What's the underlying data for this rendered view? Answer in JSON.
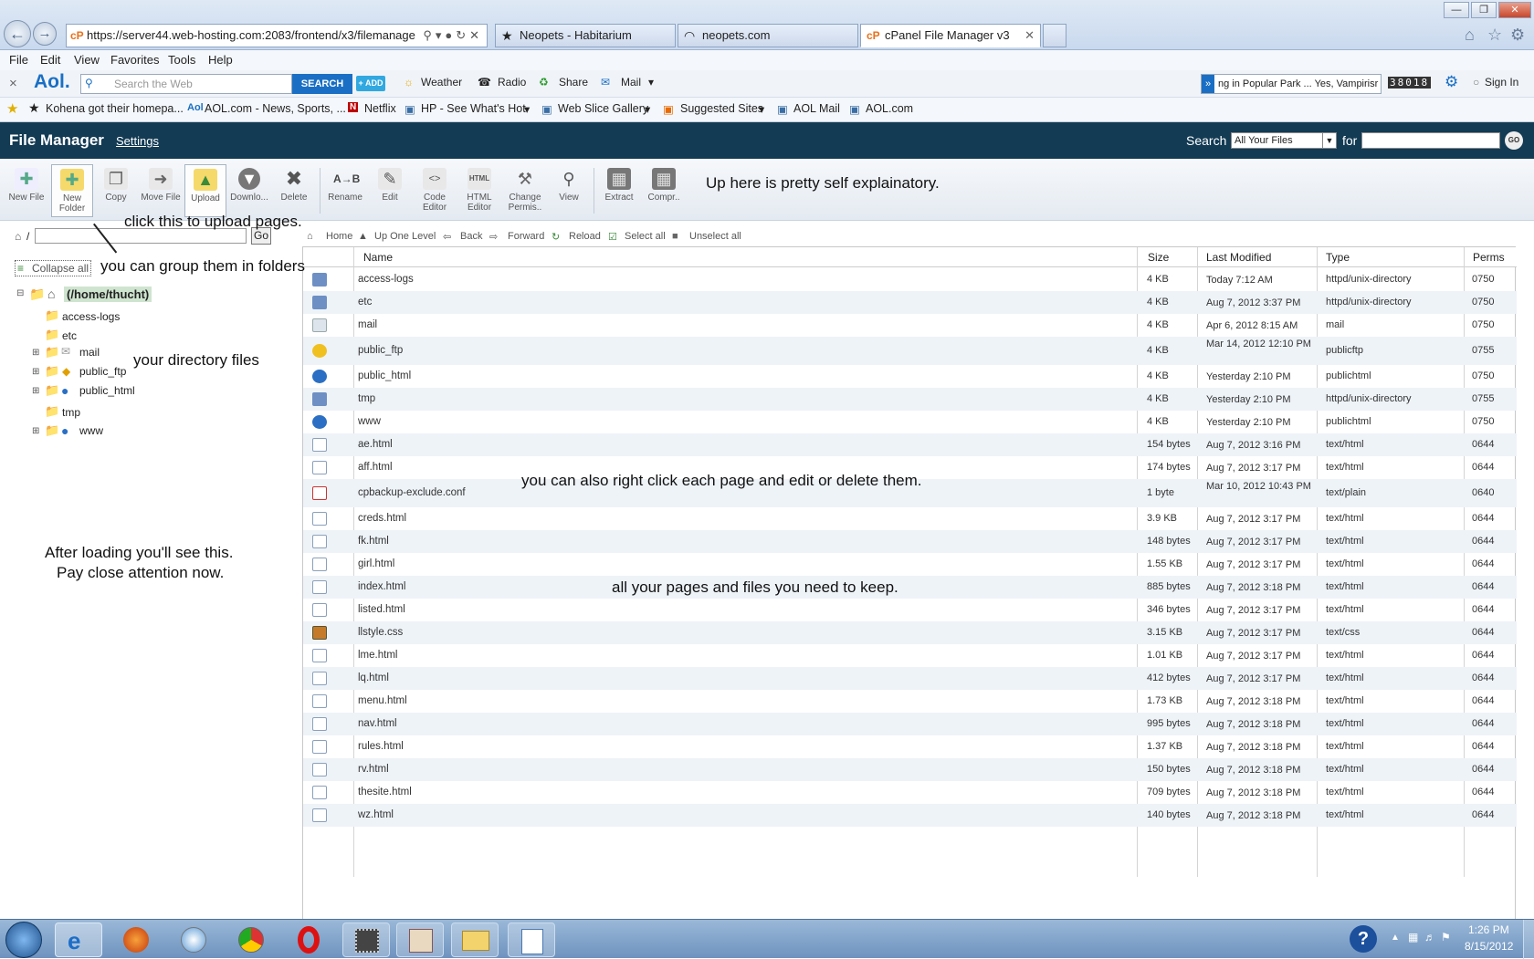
{
  "browser": {
    "address": "https://server44.web-hosting.com:2083/frontend/x3/filemanage",
    "tabs": [
      {
        "label": "Neopets - Habitarium",
        "icon": "star-icon"
      },
      {
        "label": "neopets.com",
        "icon": "loading-icon"
      },
      {
        "label": "cPanel File Manager v3",
        "icon": "cpanel-icon",
        "active": true
      }
    ],
    "menu": [
      "File",
      "Edit",
      "View",
      "Favorites",
      "Tools",
      "Help"
    ],
    "aol": {
      "logo": "Aol.",
      "search_placeholder": "Search the Web",
      "search_button": "SEARCH",
      "add_button": "+ ADD",
      "items": [
        "Weather",
        "Radio",
        "Share",
        "Mail"
      ],
      "ticker": "ng in Popular Park ...  Yes, Vampirisr",
      "counter": "38018",
      "sign_in": "Sign In"
    },
    "favorites": [
      "Kohena got their homepa...",
      "AOL.com - News, Sports, ...",
      "Netflix",
      "HP - See What's Hot",
      "Web Slice Gallery",
      "Suggested Sites",
      "AOL Mail",
      "AOL.com"
    ]
  },
  "cpanel": {
    "title": "File Manager",
    "settings": "Settings",
    "search_label": "Search",
    "search_scope": "All Your Files",
    "for_label": "for",
    "go": "GO",
    "toolbar": [
      {
        "label": "New File",
        "icon": "new-file-icon"
      },
      {
        "label": "New Folder",
        "icon": "new-folder-icon",
        "selected": true
      },
      {
        "label": "Copy",
        "icon": "copy-icon"
      },
      {
        "label": "Move File",
        "icon": "move-file-icon"
      },
      {
        "label": "Upload",
        "icon": "upload-icon",
        "selected": true
      },
      {
        "label": "Downlo...",
        "icon": "download-icon"
      },
      {
        "label": "Delete",
        "icon": "delete-icon"
      },
      {
        "label": "Rename",
        "icon": "rename-icon"
      },
      {
        "label": "Edit",
        "icon": "edit-icon"
      },
      {
        "label": "Code Editor",
        "icon": "code-editor-icon"
      },
      {
        "label": "HTML Editor",
        "icon": "html-editor-icon"
      },
      {
        "label": "Change Permis..",
        "icon": "permissions-icon"
      },
      {
        "label": "View",
        "icon": "view-icon"
      },
      {
        "label": "Extract",
        "icon": "extract-icon"
      },
      {
        "label": "Compr..",
        "icon": "compress-icon"
      }
    ],
    "path_prefix": "/",
    "path_go": "Go",
    "collapse_all": "Collapse all",
    "tree_root": "(/home/thucht)",
    "tree": [
      "access-logs",
      "etc",
      "mail",
      "public_ftp",
      "public_html",
      "tmp",
      "www"
    ],
    "nav": [
      "Home",
      "Up One Level",
      "Back",
      "Forward",
      "Reload",
      "Select all",
      "Unselect all"
    ],
    "columns": [
      "Name",
      "Size",
      "Last Modified",
      "Type",
      "Perms"
    ],
    "files": [
      {
        "name": "access-logs",
        "size": "4 KB",
        "modified": "Today 7:12 AM",
        "type": "httpd/unix-directory",
        "perms": "0750",
        "icon": "folder-icon"
      },
      {
        "name": "etc",
        "size": "4 KB",
        "modified": "Aug 7, 2012 3:37 PM",
        "type": "httpd/unix-directory",
        "perms": "0750",
        "icon": "folder-icon"
      },
      {
        "name": "mail",
        "size": "4 KB",
        "modified": "Apr 6, 2012 8:15 AM",
        "type": "mail",
        "perms": "0750",
        "icon": "mail-icon"
      },
      {
        "name": "public_ftp",
        "size": "4 KB",
        "modified": "Mar 14, 2012 12:10 PM",
        "type": "publicftp",
        "perms": "0755",
        "icon": "ftp-icon"
      },
      {
        "name": "public_html",
        "size": "4 KB",
        "modified": "Yesterday 2:10 PM",
        "type": "publichtml",
        "perms": "0750",
        "icon": "globe-icon"
      },
      {
        "name": "tmp",
        "size": "4 KB",
        "modified": "Yesterday 2:10 PM",
        "type": "httpd/unix-directory",
        "perms": "0755",
        "icon": "folder-icon"
      },
      {
        "name": "www",
        "size": "4 KB",
        "modified": "Yesterday 2:10 PM",
        "type": "publichtml",
        "perms": "0750",
        "icon": "globe-icon"
      },
      {
        "name": "ae.html",
        "size": "154 bytes",
        "modified": "Aug 7, 2012 3:16 PM",
        "type": "text/html",
        "perms": "0644",
        "icon": "html-file-icon"
      },
      {
        "name": "aff.html",
        "size": "174 bytes",
        "modified": "Aug 7, 2012 3:17 PM",
        "type": "text/html",
        "perms": "0644",
        "icon": "html-file-icon"
      },
      {
        "name": "cpbackup-exclude.conf",
        "size": "1 byte",
        "modified": "Mar 10, 2012 10:43 PM",
        "type": "text/plain",
        "perms": "0640",
        "icon": "text-file-icon"
      },
      {
        "name": "creds.html",
        "size": "3.9 KB",
        "modified": "Aug 7, 2012 3:17 PM",
        "type": "text/html",
        "perms": "0644",
        "icon": "html-file-icon"
      },
      {
        "name": "fk.html",
        "size": "148 bytes",
        "modified": "Aug 7, 2012 3:17 PM",
        "type": "text/html",
        "perms": "0644",
        "icon": "html-file-icon"
      },
      {
        "name": "girl.html",
        "size": "1.55 KB",
        "modified": "Aug 7, 2012 3:17 PM",
        "type": "text/html",
        "perms": "0644",
        "icon": "html-file-icon"
      },
      {
        "name": "index.html",
        "size": "885 bytes",
        "modified": "Aug 7, 2012 3:18 PM",
        "type": "text/html",
        "perms": "0644",
        "icon": "html-file-icon"
      },
      {
        "name": "listed.html",
        "size": "346 bytes",
        "modified": "Aug 7, 2012 3:17 PM",
        "type": "text/html",
        "perms": "0644",
        "icon": "html-file-icon"
      },
      {
        "name": "llstyle.css",
        "size": "3.15 KB",
        "modified": "Aug 7, 2012 3:17 PM",
        "type": "text/css",
        "perms": "0644",
        "icon": "css-file-icon"
      },
      {
        "name": "lme.html",
        "size": "1.01 KB",
        "modified": "Aug 7, 2012 3:17 PM",
        "type": "text/html",
        "perms": "0644",
        "icon": "html-file-icon"
      },
      {
        "name": "lq.html",
        "size": "412 bytes",
        "modified": "Aug 7, 2012 3:17 PM",
        "type": "text/html",
        "perms": "0644",
        "icon": "html-file-icon"
      },
      {
        "name": "menu.html",
        "size": "1.73 KB",
        "modified": "Aug 7, 2012 3:18 PM",
        "type": "text/html",
        "perms": "0644",
        "icon": "html-file-icon"
      },
      {
        "name": "nav.html",
        "size": "995 bytes",
        "modified": "Aug 7, 2012 3:18 PM",
        "type": "text/html",
        "perms": "0644",
        "icon": "html-file-icon"
      },
      {
        "name": "rules.html",
        "size": "1.37 KB",
        "modified": "Aug 7, 2012 3:18 PM",
        "type": "text/html",
        "perms": "0644",
        "icon": "html-file-icon"
      },
      {
        "name": "rv.html",
        "size": "150 bytes",
        "modified": "Aug 7, 2012 3:18 PM",
        "type": "text/html",
        "perms": "0644",
        "icon": "html-file-icon"
      },
      {
        "name": "thesite.html",
        "size": "709 bytes",
        "modified": "Aug 7, 2012 3:18 PM",
        "type": "text/html",
        "perms": "0644",
        "icon": "html-file-icon"
      },
      {
        "name": "wz.html",
        "size": "140 bytes",
        "modified": "Aug 7, 2012 3:18 PM",
        "type": "text/html",
        "perms": "0644",
        "icon": "html-file-icon"
      }
    ]
  },
  "annotations": {
    "self_explanatory": "Up here is pretty self explainatory.",
    "upload": "click this to upload pages.",
    "folders": "you can group them in folders",
    "directory": "your directory files",
    "after_loading_1": "After loading you'll see this.",
    "after_loading_2": "Pay close attention now.",
    "right_click": "you can  also right click each page and edit or delete them.",
    "keep": "all your pages and files you need to keep."
  },
  "taskbar": {
    "time": "1:26 PM",
    "date": "8/15/2012",
    "apps": [
      "start-orb-icon",
      "internet-explorer-icon",
      "firefox-icon",
      "safari-icon",
      "chrome-icon",
      "opera-icon",
      "film-icon",
      "paint-icon",
      "explorer-folder-icon",
      "notepad-icon"
    ]
  },
  "colors": {
    "cpanel_header": "#133b54",
    "row_alt": "#eef3f8",
    "aol_blue": "#1a6fc4"
  }
}
